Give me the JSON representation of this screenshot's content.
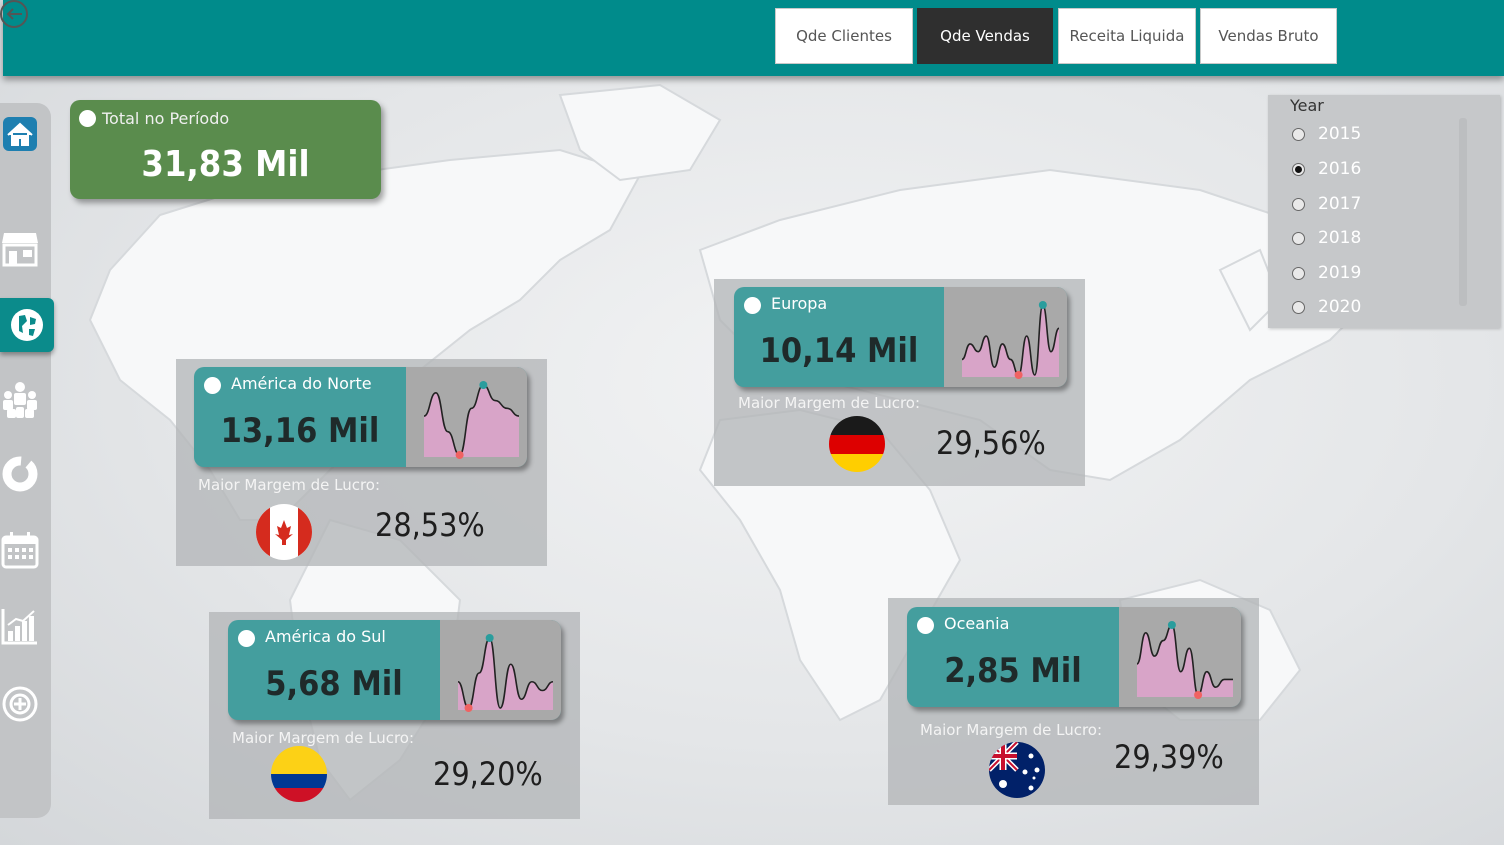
{
  "nav": {
    "buttons": [
      {
        "label": "Qde Clientes",
        "active": false
      },
      {
        "label": "Qde Vendas",
        "active": true
      },
      {
        "label": "Receita Liquida",
        "active": false
      },
      {
        "label": "Vendas Bruto",
        "active": false
      }
    ]
  },
  "sidebar": {
    "items": [
      {
        "icon": "home-icon",
        "active": false
      },
      {
        "icon": "store-icon",
        "active": false
      },
      {
        "icon": "globe-icon",
        "active": true
      },
      {
        "icon": "people-icon",
        "active": false
      },
      {
        "icon": "donut-chart-icon",
        "active": false
      },
      {
        "icon": "calendar-icon",
        "active": false
      },
      {
        "icon": "bar-chart-icon",
        "active": false
      },
      {
        "icon": "target-icon",
        "active": false
      }
    ]
  },
  "total": {
    "label": "Total no Período",
    "value": "31,83 Mil"
  },
  "year_filter": {
    "title": "Year",
    "selected": "2016",
    "options": [
      "2015",
      "2016",
      "2017",
      "2018",
      "2019",
      "2020"
    ]
  },
  "regions": {
    "north_america": {
      "name": "América do Norte",
      "value": "13,16 Mil",
      "margin_label": "Maior Margem de Lucro:",
      "margin": "28,53%",
      "flag": "canada-flag"
    },
    "europe": {
      "name": "Europa",
      "value": "10,14 Mil",
      "margin_label": "Maior Margem de Lucro:",
      "margin": "29,56%",
      "flag": "germany-flag"
    },
    "south_america": {
      "name": "América do Sul",
      "value": "5,68 Mil",
      "margin_label": "Maior Margem de Lucro:",
      "margin": "29,20%",
      "flag": "colombia-flag"
    },
    "oceania": {
      "name": "Oceania",
      "value": "2,85 Mil",
      "margin_label": "Maior Margem de Lucro:",
      "margin": "29,39%",
      "flag": "australia-flag"
    }
  },
  "colors": {
    "header": "#008b8b",
    "card": "#449e9e",
    "total_card": "#5a8c4d",
    "spark_fill": "#d8a4c8",
    "spark_max": "#2a9d9d",
    "spark_min": "#f06262"
  },
  "chart_data": [
    {
      "type": "area",
      "series": [
        {
          "values": [
            6,
            9,
            4,
            1,
            7,
            10,
            8,
            7,
            6
          ]
        }
      ],
      "highlight": {
        "max_index": 5,
        "min_index": 3
      }
    },
    {
      "type": "area",
      "series": [
        {
          "values": [
            3,
            5,
            4,
            6,
            2,
            5,
            3,
            1,
            6,
            1,
            10,
            4,
            7
          ]
        }
      ],
      "highlight": {
        "max_index": 10,
        "min_index": 7
      }
    },
    {
      "type": "area",
      "series": [
        {
          "values": [
            5,
            2,
            6,
            10,
            2,
            7,
            3,
            5,
            4,
            5
          ]
        }
      ],
      "highlight": {
        "max_index": 3,
        "min_index": 1
      }
    },
    {
      "type": "area",
      "series": [
        {
          "values": [
            5,
            9,
            6,
            8,
            10,
            4,
            7,
            1,
            4,
            2,
            3,
            3
          ]
        }
      ],
      "highlight": {
        "max_index": 4,
        "min_index": 7
      }
    }
  ]
}
